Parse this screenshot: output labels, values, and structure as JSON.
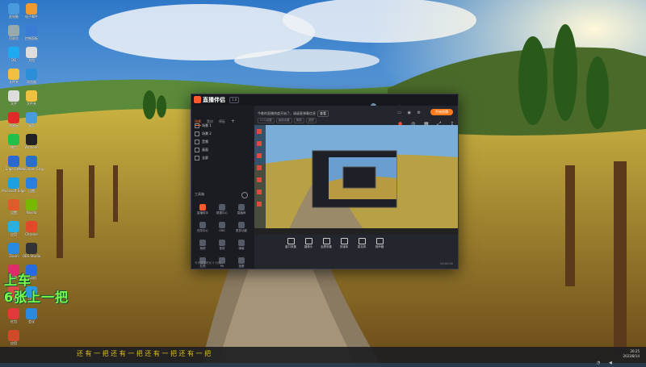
{
  "desktop": {
    "icons": [
      {
        "label": "此电脑",
        "icon": "computer-icon",
        "color": "#4a9ade"
      },
      {
        "label": "电子邮件",
        "icon": "browser-icon",
        "color": "#f29a2e"
      },
      {
        "label": "回收站",
        "icon": "recycle-icon",
        "color": "#9aa"
      },
      {
        "label": "控制面板",
        "icon": "control-panel-icon",
        "color": "#3a7bd5"
      },
      {
        "label": "QQ",
        "icon": "qq-icon",
        "color": "#1eaaf1"
      },
      {
        "label": "文档",
        "icon": "file-icon",
        "color": "#ddd"
      },
      {
        "label": "文件夹",
        "icon": "folder-icon",
        "color": "#f0c040"
      },
      {
        "label": "浏览器",
        "icon": "browser-icon",
        "color": "#2a8fd8"
      },
      {
        "label": "文件",
        "icon": "file-icon",
        "color": "#ddd"
      },
      {
        "label": "文件夹",
        "icon": "folder-icon",
        "color": "#f0c040"
      },
      {
        "label": "网易云",
        "icon": "music-icon",
        "color": "#e02a2a"
      },
      {
        "label": "桌面",
        "icon": "monitor-icon",
        "color": "#4a9ade"
      },
      {
        "label": "微信",
        "icon": "wechat-icon",
        "color": "#22c04a"
      },
      {
        "label": "Warzone",
        "icon": "game-icon",
        "color": "#222"
      },
      {
        "label": "Edge Beta",
        "icon": "edge-icon",
        "color": "#2a6ad0"
      },
      {
        "label": "Wallpaper Engine",
        "icon": "wallpaper-icon",
        "color": "#2a70c8"
      },
      {
        "label": "Microsoft Edge",
        "icon": "edge-icon",
        "color": "#1ea0e0"
      },
      {
        "label": "迅雷",
        "icon": "download-icon",
        "color": "#2a80e0"
      },
      {
        "label": "设置",
        "icon": "gear-icon",
        "color": "#e05a2a"
      },
      {
        "label": "Nvidia",
        "icon": "nvidia-icon",
        "color": "#76b900"
      },
      {
        "label": "应用",
        "icon": "app-icon",
        "color": "#2ab0e0"
      },
      {
        "label": "Chrome",
        "icon": "chrome-icon",
        "color": "#e04a2a"
      },
      {
        "label": "Zoom",
        "icon": "zoom-icon",
        "color": "#2a8ae0"
      },
      {
        "label": "OBS Studio",
        "icon": "obs-icon",
        "color": "#333"
      },
      {
        "label": "应用",
        "icon": "app-icon",
        "color": "#e02a6a"
      },
      {
        "label": "虚拟机",
        "icon": "vm-icon",
        "color": "#2a6ae0"
      },
      {
        "label": "应用",
        "icon": "app-icon",
        "color": "#e04a4a"
      },
      {
        "label": "远程",
        "icon": "remote-icon",
        "color": "#2a9ae0"
      },
      {
        "label": "红包",
        "icon": "app-icon",
        "color": "#e03a3a"
      },
      {
        "label": "会议",
        "icon": "meeting-icon",
        "color": "#2a8ae0"
      },
      {
        "label": "应用",
        "icon": "app-icon",
        "color": "#d04a2a"
      }
    ],
    "overlay_line1": "上车",
    "overlay_line2": "6张上一把"
  },
  "app": {
    "title": "直播伴侣",
    "version_badge": "1.0",
    "tabs": [
      "场景",
      "素材",
      "模板"
    ],
    "scenes": [
      "场景 1",
      "场景 2",
      "音频",
      "画面",
      "全屏"
    ],
    "notice": "今晚的直播热度开始了，请留意弹幕信息",
    "notice_button": "查看",
    "sub_tags": [
      "CCQ设置",
      "画面设置",
      "美颜",
      "滤镜"
    ],
    "tools_title": "工具箱",
    "tools": [
      {
        "label": "直播助手",
        "icon": "record-icon",
        "color": "#ff5a2b"
      },
      {
        "label": "数据中心",
        "icon": "chart-icon",
        "color": "#555a66"
      },
      {
        "label": "直播间",
        "icon": "room-icon",
        "color": "#555a66"
      },
      {
        "label": "任务中心",
        "icon": "task-icon",
        "color": "#555a66"
      },
      {
        "label": "OBS",
        "icon": "obs-icon",
        "color": "#555a66"
      },
      {
        "label": "更多功能",
        "icon": "more-icon",
        "color": "#555a66"
      },
      {
        "label": "美颜",
        "icon": "beauty-icon",
        "color": "#555a66"
      },
      {
        "label": "音效",
        "icon": "audio-icon",
        "color": "#555a66"
      },
      {
        "label": "弹幕",
        "icon": "chat-icon",
        "color": "#555a66"
      },
      {
        "label": "礼物",
        "icon": "gift-icon",
        "color": "#555a66"
      },
      {
        "label": "PK",
        "icon": "pk-icon",
        "color": "#555a66"
      },
      {
        "label": "投屏",
        "icon": "cast-icon",
        "color": "#555a66"
      }
    ],
    "left_footer": "今天直播时长 0 分钟",
    "controls": [
      {
        "label": "窗口采集",
        "icon": "window-icon"
      },
      {
        "label": "摄像头",
        "icon": "camera-icon"
      },
      {
        "label": "全屏采集",
        "icon": "screen-icon"
      },
      {
        "label": "多媒体",
        "icon": "media-icon"
      },
      {
        "label": "麦克风",
        "icon": "mic-icon"
      },
      {
        "label": "扬声器",
        "icon": "speaker-icon"
      }
    ],
    "go_live": "开始直播",
    "status": "00:00:00",
    "accent": "#ff7a1a"
  },
  "taskbar": {
    "marquee": "还  有  一  把  还  有  一  把  还  有  一  把  还  有  一  把",
    "time": "20:25",
    "date": "2023/8/14"
  }
}
